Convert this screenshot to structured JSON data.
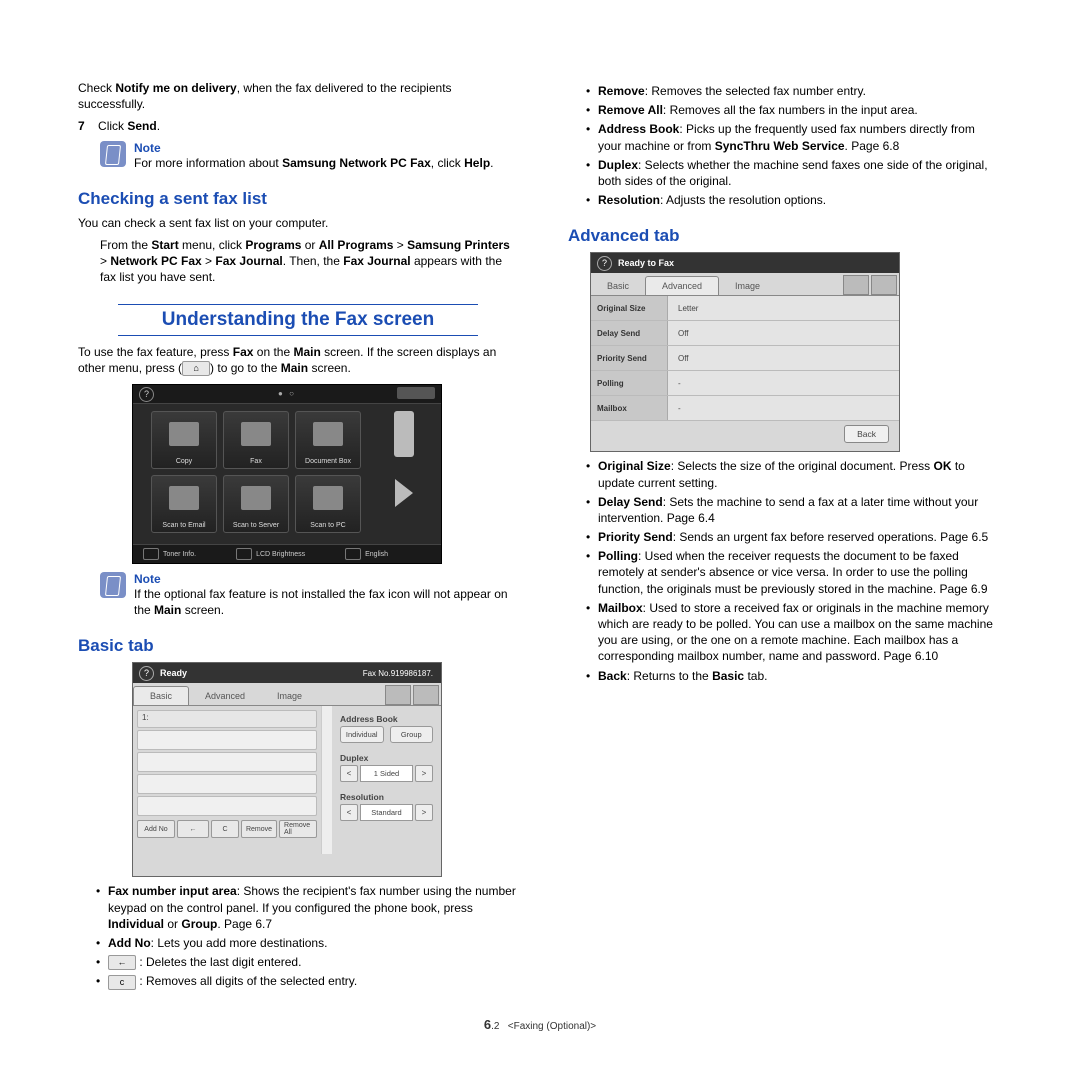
{
  "col_left": {
    "intro_p1a": "Check ",
    "intro_p1b": "Notify me on delivery",
    "intro_p1c": ", when the fax delivered to the recipients successfully.",
    "step7_num": "7",
    "step7a": "Click ",
    "step7b": "Send",
    "step7c": ".",
    "note1_title": "Note",
    "note1a": "For more information about  ",
    "note1b": "Samsung Network PC Fax",
    "note1c": ", click ",
    "note1d": "Help",
    "note1e": ".",
    "subhead1": "Checking a sent fax list",
    "p_check": "You can check a sent fax list on your computer.",
    "p_from_a": "From the ",
    "p_from_b": "Start",
    "p_from_c": " menu, click ",
    "p_from_d": "Programs",
    "p_from_e": " or ",
    "p_from_f": "All Programs",
    "p_from_g": " > ",
    "p_from_h": "Samsung Printers",
    "p_from_i": " > ",
    "p_from_j": "Network PC Fax",
    "p_from_k": " > ",
    "p_from_l": "Fax Journal",
    "p_from_m": ". Then, the ",
    "p_from_n": "Fax Journal",
    "p_from_o": " appears with the fax list you have sent.",
    "section_title": "Understanding the Fax screen",
    "p_use_a": "To use the fax feature, press ",
    "p_use_b": "Fax",
    "p_use_c": " on the ",
    "p_use_d": "Main",
    "p_use_e": " screen. If the screen displays an other menu, press (",
    "p_use_f": ") to go to the ",
    "p_use_g": "Main",
    "p_use_h": " screen.",
    "main_icon_label": "⌂",
    "note2_title": "Note",
    "note2a": "If the optional fax feature is not installed the fax icon will not appear on the ",
    "note2b": "Main",
    "note2c": " screen.",
    "subhead_basic": "Basic tab",
    "bullets_basic": {
      "i1a": "Fax number input area",
      "i1b": ": Shows the recipient's fax number using the number keypad on the control panel. If you configured the phone book, press ",
      "i1c": "Individual",
      "i1d": " or ",
      "i1e": "Group",
      "i1f": ". Page 6.7",
      "i2a": "Add No",
      "i2b": ": Lets you add more destinations.",
      "i3b": ": Deletes the last digit entered.",
      "i4b": ": Removes all digits of the selected entry."
    },
    "back_icon_label": "←",
    "c_icon_label": "c"
  },
  "main_screen": {
    "tiles": [
      "Copy",
      "Fax",
      "Document Box",
      "Scan to Email",
      "Scan to Server",
      "Scan to PC"
    ],
    "bottom": [
      "Toner Info.",
      "LCD Brightness",
      "English"
    ]
  },
  "basic_screen": {
    "ready": "Ready",
    "faxno": "Fax No.919986187.",
    "tabs": [
      "Basic",
      "Advanced",
      "Image"
    ],
    "first_row": "1:",
    "btm_btns": [
      "Add No",
      "←",
      "C",
      "Remove",
      "Remove All"
    ],
    "r_lbl1": "Address Book",
    "r_pill1": "Individual",
    "r_pill2": "Group",
    "r_lbl2": "Duplex",
    "r_spin1": "1 Sided",
    "r_lbl3": "Resolution",
    "r_spin2": "Standard"
  },
  "col_right": {
    "bullets_top": {
      "i1a": "Remove",
      "i1b": ": Removes the selected fax number entry.",
      "i2a": "Remove All",
      "i2b": ": Removes all the fax numbers in the input area.",
      "i3a": "Address Book",
      "i3b": ": Picks up the frequently used fax numbers directly from your machine or from ",
      "i3c": "SyncThru Web Service",
      "i3d": ". Page 6.8",
      "i4a": "Duplex",
      "i4b": ": Selects whether the machine send faxes one side of the original, both sides of the original.",
      "i5a": "Resolution",
      "i5b": ": Adjusts the resolution options."
    },
    "subhead_adv": "Advanced tab",
    "bullets_adv": {
      "i1a": "Original Size",
      "i1b": ": Selects the size of the original document. Press ",
      "i1c": "OK",
      "i1d": " to update current setting.",
      "i2a": "Delay Send",
      "i2b": ": Sets the machine to send a fax at a later time without your intervention. Page 6.4",
      "i3a": "Priority Send",
      "i3b": ": Sends an urgent fax before reserved operations. Page 6.5",
      "i4a": "Polling",
      "i4b": ": Used when the receiver requests the document to be faxed remotely at sender's absence or vice versa. In order to use the polling function, the originals must be previously stored in the machine. Page 6.9",
      "i5a": "Mailbox",
      "i5b": ": Used to store a received fax or originals in the machine memory which are ready to be polled. You can use a mailbox on the same machine you are using, or the one on a remote machine. Each mailbox has a corresponding mailbox number, name and password. Page 6.10",
      "i6a": "Back",
      "i6b": ": Returns to the ",
      "i6c": "Basic",
      "i6d": " tab."
    }
  },
  "adv_screen": {
    "ready": "Ready to Fax",
    "tabs": [
      "Basic",
      "Advanced",
      "Image"
    ],
    "rows": [
      {
        "k": "Original Size",
        "v": "Letter"
      },
      {
        "k": "Delay Send",
        "v": "Off"
      },
      {
        "k": "Priority Send",
        "v": "Off"
      },
      {
        "k": "Polling",
        "v": "-"
      },
      {
        "k": "Mailbox",
        "v": "-"
      }
    ],
    "back": "Back"
  },
  "footer": {
    "num_big": "6",
    "num_small": ".2",
    "label": "<Faxing (Optional)>"
  }
}
